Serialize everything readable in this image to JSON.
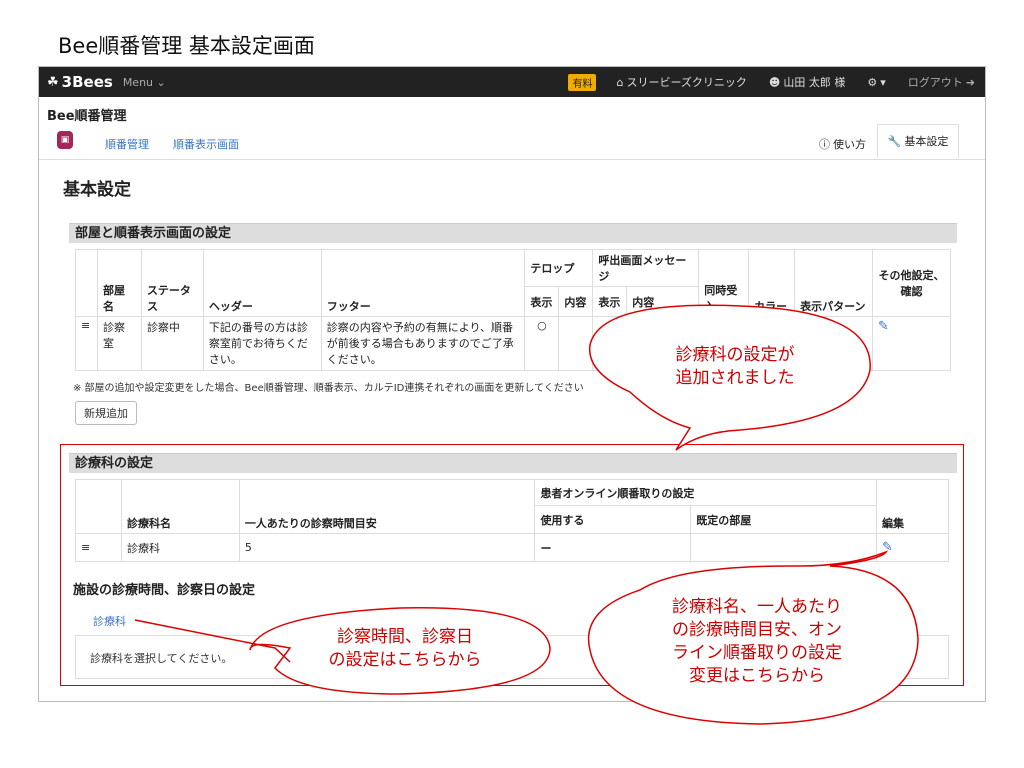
{
  "slide": {
    "title": "Bee順番管理  基本設定画面"
  },
  "navbar": {
    "brand": "3Bees",
    "menu": "Menu",
    "plan_badge": "有料",
    "clinic": "スリービーズクリニック",
    "user": "山田 太郎 様",
    "logout": "ログアウト"
  },
  "app": {
    "name": "Bee順番管理"
  },
  "tabs": {
    "items": [
      {
        "label": "順番管理"
      },
      {
        "label": "順番表示画面"
      }
    ],
    "help": "使い方",
    "settings": "基本設定"
  },
  "page": {
    "title": "基本設定"
  },
  "rooms_section": {
    "title": "部屋と順番表示画面の設定",
    "group_headers": {
      "telop": "テロップ",
      "call_message": "呼出画面メッセージ"
    },
    "columns": {
      "room": "部屋名",
      "status": "ステータス",
      "header": "ヘッダー",
      "footer": "フッター",
      "telop_show": "表示",
      "telop_content": "内容",
      "msg_show": "表示",
      "msg_content": "内容",
      "simultaneous": "同時受入",
      "color": "カラー",
      "pattern": "表示パターン",
      "other": "その他設定、確認"
    },
    "rows": [
      {
        "room": "診察室",
        "status": "診察中",
        "header": "下記の番号の方は診察室前でお待ちください。",
        "footer": "診察の内容や予約の有無により、順番が前後する場合もありますのでご了承ください。",
        "telop_show": "○",
        "msg_show": "○"
      }
    ],
    "note": "※ 部屋の追加や設定変更をした場合、Bee順番管理、順番表示、カルテID連携それぞれの画面を更新してください",
    "add_button": "新規追加"
  },
  "dept_section": {
    "title": "診療科の設定",
    "group_header": "患者オンライン順番取りの設定",
    "columns": {
      "name": "診療科名",
      "time": "一人あたりの診察時間目安",
      "use": "使用する",
      "default_room": "既定の部屋",
      "edit": "編集"
    },
    "rows": [
      {
        "name": "診療科",
        "time": "5",
        "use": "ー"
      }
    ]
  },
  "facility_section": {
    "title": "施設の診療時間、診察日の設定",
    "dept_link": "診療科",
    "select_prompt": "診療科を選択してください。"
  },
  "callouts": {
    "added_line1": "診療科の設定が",
    "added_line2": "追加されました",
    "time_line1": "診察時間、診察日",
    "time_line2": "の設定はこちらから",
    "edit_line1": "診療科名、一人あたり",
    "edit_line2": "の診療時間目安、オン",
    "edit_line3": "ライン順番取りの設定",
    "edit_line4": "変更はこちらから"
  },
  "colors": {
    "accent_red": "#cc0000",
    "link_blue": "#3a74c4",
    "navbar": "#222222"
  }
}
